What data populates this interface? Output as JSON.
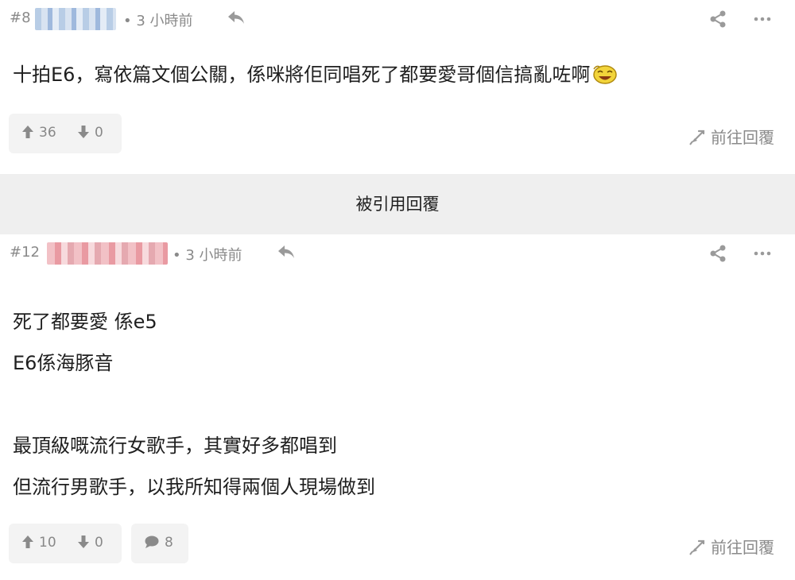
{
  "posts": [
    {
      "number": "#8",
      "meta": "• 3 小時前",
      "content_lines": [
        "十拍E6，寫依篇文個公關，係咪將佢同唱死了都要愛哥個信搞亂咗啊"
      ],
      "upvotes": "36",
      "downvotes": "0",
      "goto_reply": "前往回覆"
    },
    {
      "number": "#12",
      "meta": "• 3 小時前",
      "content_lines": [
        "死了都要愛 係e5",
        "E6係海豚音",
        "",
        "最頂級嘅流行女歌手，其實好多都唱到",
        "但流行男歌手，以我所知得兩個人現場做到"
      ],
      "upvotes": "10",
      "downvotes": "0",
      "comments": "8",
      "goto_reply": "前往回覆"
    }
  ],
  "quote_banner": "被引用回覆",
  "icons": {
    "reply": "reply-arrow-icon",
    "share": "share-icon",
    "more": "more-dots-icon",
    "upvote": "thumb-up-arrow-icon",
    "downvote": "thumb-down-arrow-icon",
    "comment": "comment-bubble-icon",
    "goto": "goto-reply-icon",
    "emoji": "laughing-emoji-icon"
  },
  "colors": {
    "muted_text": "#8a8a8a",
    "banner_bg": "#efefef",
    "button_bg": "#f3f3f3"
  }
}
